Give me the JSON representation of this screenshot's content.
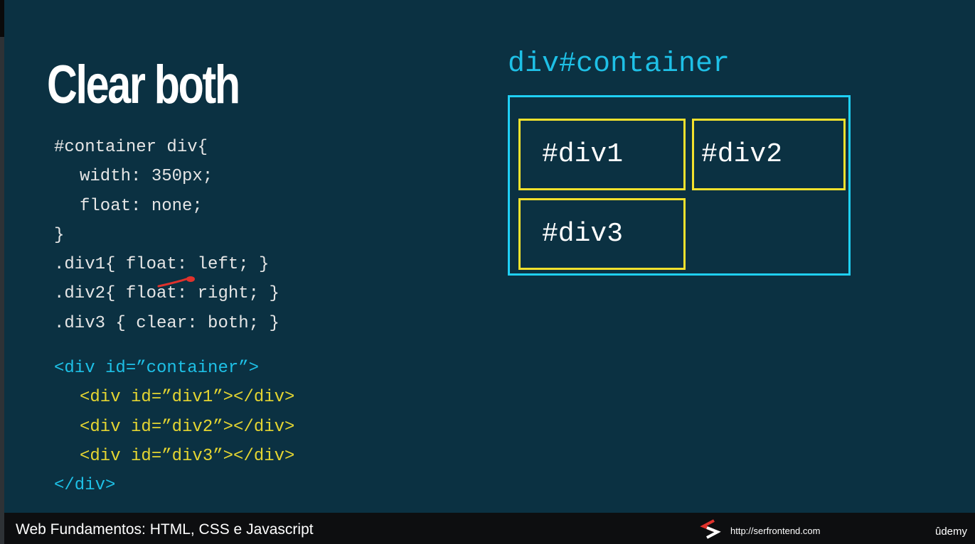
{
  "slide": {
    "title": "Clear both",
    "css_code": [
      "#container div{",
      "width: 350px;",
      "float: none;",
      "}",
      ".div1{ float: left; }",
      ".div2{ float: right; }",
      ".div3 { clear: both; }"
    ],
    "html_code": {
      "open": "<div id=”container”>",
      "children": [
        "<div id=”div1”></div>",
        "<div id=”div2”></div>",
        "<div id=”div3”></div>"
      ],
      "close": "</div>"
    },
    "diagram": {
      "container_label": "div#container",
      "boxes": [
        "#div1",
        "#div2",
        "#div3"
      ]
    }
  },
  "footer": {
    "course_title": "Web Fundamentos: HTML, CSS e Javascript",
    "site_url": "http://serfrontend.com",
    "platform": "ûdemy",
    "logo_icon": "serfrontend-logo-icon"
  },
  "colors": {
    "background": "#0b3142",
    "code_text": "#e6e6e6",
    "html_tag_container": "#1ec0e6",
    "html_tag_child": "#e4d531",
    "container_border": "#1fd0f5",
    "inner_border": "#f3e12d",
    "annotation_mark": "#e0322c"
  }
}
